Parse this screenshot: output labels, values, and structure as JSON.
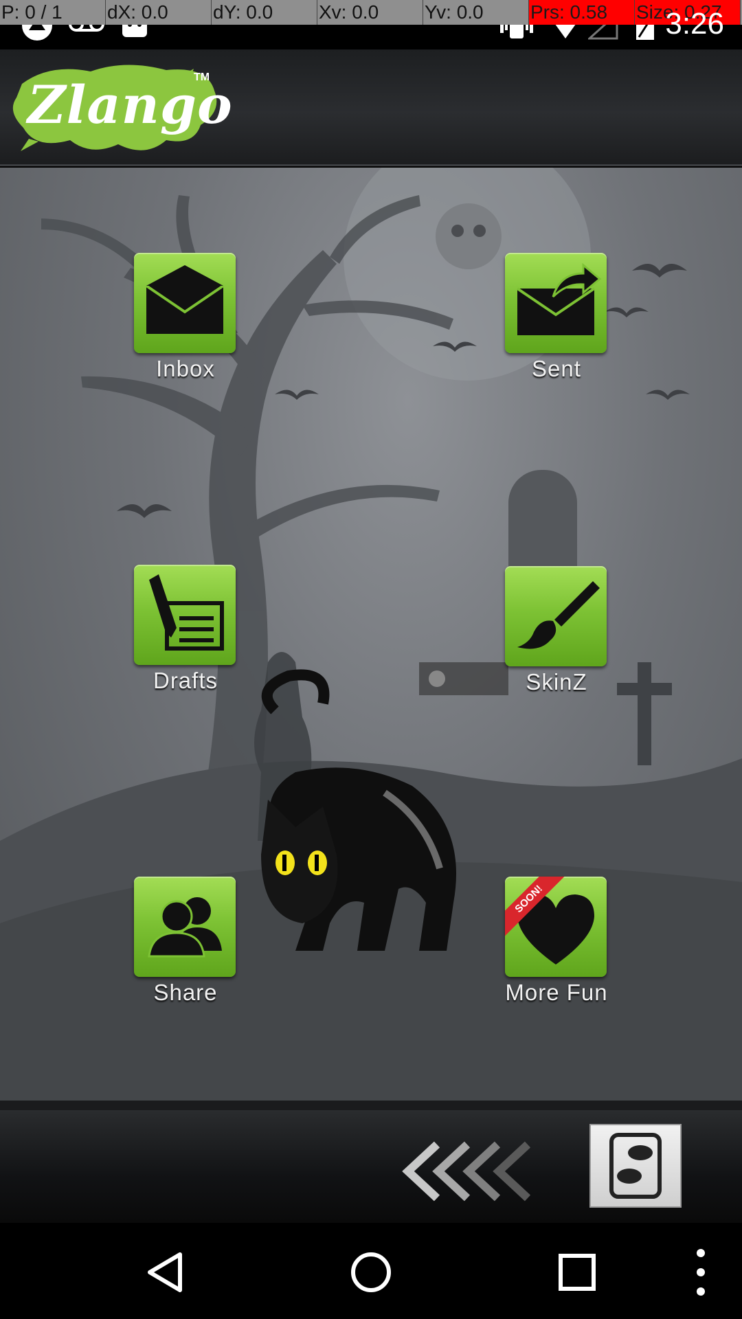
{
  "debug_bar": {
    "cells": [
      {
        "text": "P: 0 / 1",
        "alert": false
      },
      {
        "text": "dX: 0.0",
        "alert": false
      },
      {
        "text": "dY: 0.0",
        "alert": false
      },
      {
        "text": "Xv: 0.0",
        "alert": false
      },
      {
        "text": "Yv: 0.0",
        "alert": false
      },
      {
        "text": "Prs: 0.58",
        "alert": true
      },
      {
        "text": "Size: 0.27",
        "alert": true
      }
    ]
  },
  "status_bar": {
    "time": "3:26",
    "left_icons": [
      "app-notification-icon",
      "voicemail-icon",
      "android-debug-icon"
    ],
    "right_icons": [
      "vibrate-icon",
      "wifi-icon",
      "signal-icon",
      "battery-icon"
    ]
  },
  "header": {
    "logo_text": "Zlango",
    "trademark": "TM",
    "brand_color": "#8cc63f"
  },
  "menu": {
    "items": [
      {
        "label": "Inbox",
        "icon": "envelope-icon"
      },
      {
        "label": "Sent",
        "icon": "send-envelope-icon"
      },
      {
        "label": "Drafts",
        "icon": "pen-document-icon"
      },
      {
        "label": "SkinZ",
        "icon": "paintbrush-icon"
      },
      {
        "label": "Share",
        "icon": "people-icon"
      },
      {
        "label": "More Fun",
        "icon": "heart-icon",
        "badge": "SOON!"
      }
    ]
  },
  "bottom_bar": {
    "back_icon": "double-chevron-left-icon",
    "chat_icon": "chat-bubbles-icon"
  },
  "nav_bar": {
    "buttons": [
      "back-icon",
      "home-icon",
      "recents-icon",
      "overflow-menu-icon"
    ]
  },
  "colors": {
    "accent_green": "#7dc234",
    "alert_red": "#ff0000"
  }
}
